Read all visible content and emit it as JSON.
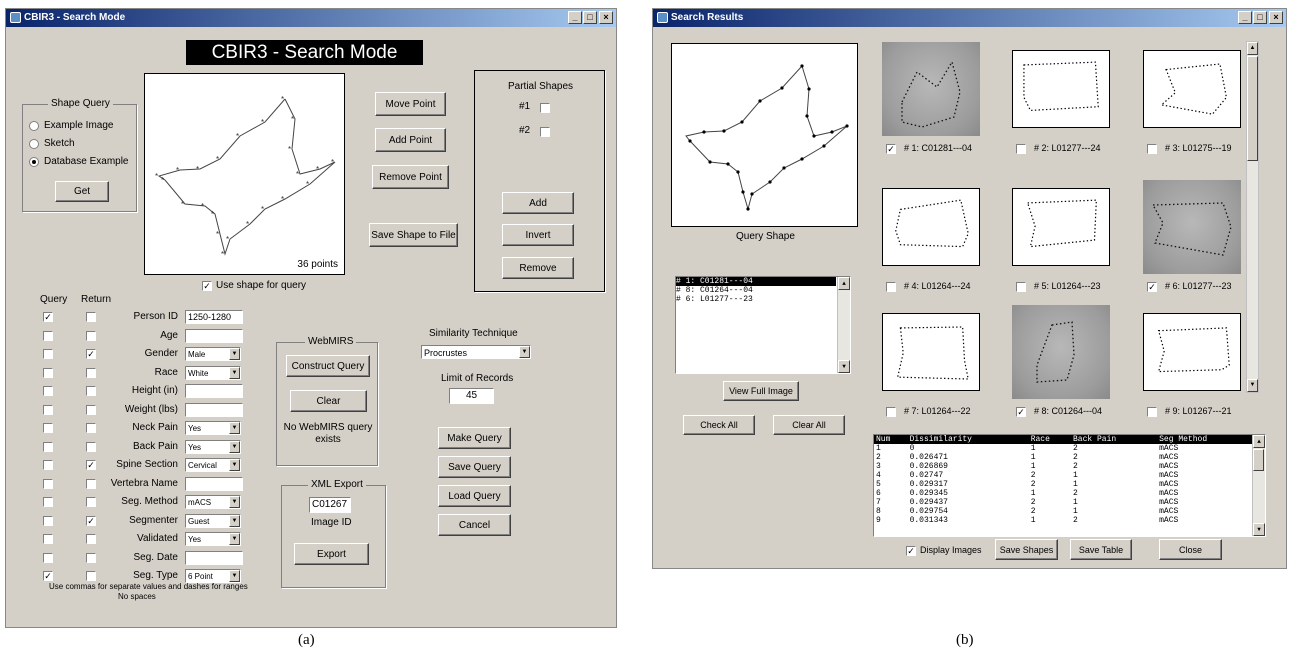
{
  "left": {
    "window_title": "CBIR3 - Search Mode",
    "banner": "CBIR3 - Search Mode",
    "shape_query": {
      "title": "Shape Query",
      "options": [
        "Example Image",
        "Sketch",
        "Database Example"
      ],
      "selected": "Database Example",
      "get_label": "Get"
    },
    "canvas": {
      "points_label": "36 points",
      "use_shape_label": "Use shape for query"
    },
    "move_point": "Move Point",
    "add_point": "Add Point",
    "remove_point": "Remove Point",
    "save_shape": "Save Shape to File",
    "partial": {
      "title": "Partial Shapes",
      "items": [
        "#1",
        "#2"
      ],
      "add": "Add",
      "invert": "Invert",
      "remove": "Remove"
    },
    "query_col": "Query",
    "return_col": "Return",
    "fields": [
      {
        "label": "Person ID",
        "kind": "text",
        "value": "1250-1280",
        "q": true,
        "r": false
      },
      {
        "label": "Age",
        "kind": "text",
        "value": "",
        "q": false,
        "r": false
      },
      {
        "label": "Gender",
        "kind": "select",
        "value": "Male",
        "q": false,
        "r": true
      },
      {
        "label": "Race",
        "kind": "select",
        "value": "White",
        "q": false,
        "r": false
      },
      {
        "label": "Height (in)",
        "kind": "text",
        "value": "",
        "q": false,
        "r": false
      },
      {
        "label": "Weight (lbs)",
        "kind": "text",
        "value": "",
        "q": false,
        "r": false
      },
      {
        "label": "Neck Pain",
        "kind": "select",
        "value": "Yes",
        "q": false,
        "r": false
      },
      {
        "label": "Back Pain",
        "kind": "select",
        "value": "Yes",
        "q": false,
        "r": false
      },
      {
        "label": "Spine Section",
        "kind": "select",
        "value": "Cervical",
        "q": false,
        "r": true
      },
      {
        "label": "Vertebra Name",
        "kind": "text",
        "value": "",
        "q": false,
        "r": false
      },
      {
        "label": "Seg. Method",
        "kind": "select",
        "value": "mACS",
        "q": false,
        "r": false
      },
      {
        "label": "Segmenter",
        "kind": "select",
        "value": "Guest",
        "q": false,
        "r": true
      },
      {
        "label": "Validated",
        "kind": "select",
        "value": "Yes",
        "q": false,
        "r": false
      },
      {
        "label": "Seg. Date",
        "kind": "text",
        "value": "",
        "q": false,
        "r": false
      },
      {
        "label": "Seg. Type",
        "kind": "select",
        "value": "6 Point",
        "q": true,
        "r": false
      }
    ],
    "note1": "Use commas for separate values and dashes for ranges",
    "note2": "No spaces",
    "webmirs": {
      "title": "WebMIRS",
      "construct": "Construct Query",
      "clear": "Clear",
      "status": "No WebMIRS query exists"
    },
    "similarity": {
      "title": "Similarity Technique",
      "value": "Procrustes",
      "limit_label": "Limit of Records",
      "limit_value": "45"
    },
    "make_query": "Make Query",
    "save_query": "Save Query",
    "load_query": "Load Query",
    "cancel": "Cancel",
    "xml": {
      "title": "XML Export",
      "image_id": "C01267",
      "image_id_label": "Image ID",
      "export": "Export"
    }
  },
  "right": {
    "window_title": "Search Results",
    "query_shape_label": "Query Shape",
    "list_items": [
      "# 1: C01281---04",
      "# 8: C01264---04",
      "# 6: L01277---23"
    ],
    "view_full": "View Full Image",
    "check_all": "Check All",
    "clear_all": "Clear All",
    "results": [
      {
        "label": "# 1: C01281---04",
        "checked": true,
        "photo": true
      },
      {
        "label": "# 2: L01277---24",
        "checked": false,
        "photo": false
      },
      {
        "label": "# 3: L01275---19",
        "checked": false,
        "photo": false
      },
      {
        "label": "# 4: L01264---24",
        "checked": false,
        "photo": false
      },
      {
        "label": "# 5: L01264---23",
        "checked": false,
        "photo": false
      },
      {
        "label": "# 6: L01277---23",
        "checked": true,
        "photo": true
      },
      {
        "label": "# 7: L01264---22",
        "checked": false,
        "photo": false
      },
      {
        "label": "# 8: C01264---04",
        "checked": true,
        "photo": true
      },
      {
        "label": "# 9: L01267---21",
        "checked": false,
        "photo": false
      }
    ],
    "table": {
      "headers": [
        "Num",
        "Dissimilarity",
        "Race",
        "Back Pain",
        "Seg Method"
      ],
      "rows": [
        [
          "1",
          "0",
          "1",
          "2",
          "mACS"
        ],
        [
          "2",
          "0.026471",
          "1",
          "2",
          "mACS"
        ],
        [
          "3",
          "0.026869",
          "1",
          "2",
          "mACS"
        ],
        [
          "4",
          "0.02747",
          "2",
          "1",
          "mACS"
        ],
        [
          "5",
          "0.029317",
          "2",
          "1",
          "mACS"
        ],
        [
          "6",
          "0.029345",
          "1",
          "2",
          "mACS"
        ],
        [
          "7",
          "0.029437",
          "2",
          "1",
          "mACS"
        ],
        [
          "8",
          "0.029754",
          "2",
          "1",
          "mACS"
        ],
        [
          "9",
          "0.031343",
          "1",
          "2",
          "mACS"
        ]
      ]
    },
    "display_images": "Display Images",
    "save_shapes": "Save Shapes",
    "save_table": "Save Table",
    "close": "Close"
  },
  "captions": {
    "a": "(a)",
    "b": "(b)"
  }
}
